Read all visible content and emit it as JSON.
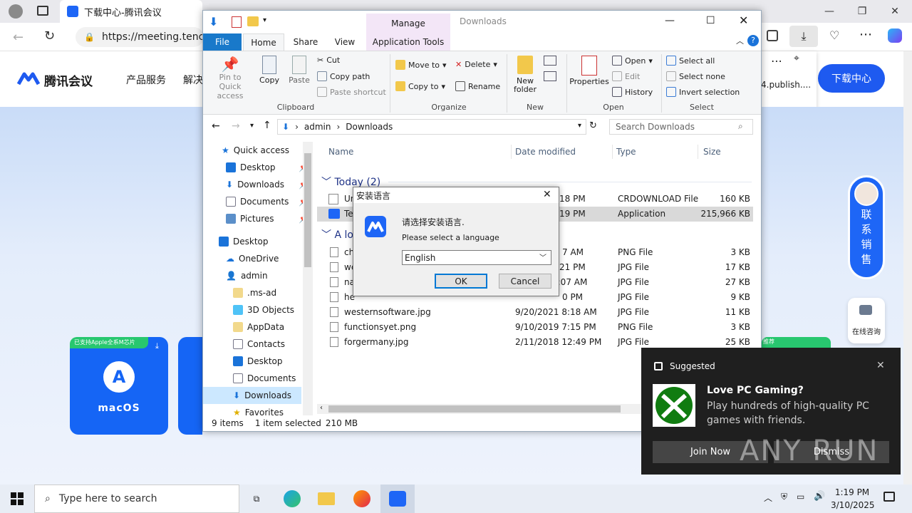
{
  "browser": {
    "tab_title": "下载中心-腾讯会议",
    "url": "https://meeting.tencen",
    "dl_panel_text": "4.publish...."
  },
  "site": {
    "logo_text": "腾讯会议",
    "nav": [
      "产品服务",
      "解决"
    ],
    "download_center": "下载中心",
    "sales_chars": [
      "联",
      "系",
      "销",
      "售"
    ],
    "consult": "在线咨询",
    "card_badge": "已支持Apple全系M芯片",
    "card_label": "macOS",
    "card_tag": "推荐"
  },
  "explorer": {
    "title": "Downloads",
    "manage_tab": "Manage",
    "tabs": [
      "File",
      "Home",
      "Share",
      "View",
      "Application Tools"
    ],
    "clipboard": {
      "pin": "Pin to Quick access",
      "copy": "Copy",
      "paste": "Paste",
      "cut": "Cut",
      "copy_path": "Copy path",
      "paste_shortcut": "Paste shortcut",
      "label": "Clipboard"
    },
    "organize": {
      "move_to": "Move to",
      "copy_to": "Copy to",
      "delete": "Delete",
      "rename": "Rename",
      "label": "Organize"
    },
    "new": {
      "new_folder": "New folder",
      "label": "New"
    },
    "open": {
      "properties": "Properties",
      "open": "Open",
      "edit": "Edit",
      "history": "History",
      "label": "Open"
    },
    "select": {
      "select_all": "Select all",
      "select_none": "Select none",
      "invert": "Invert selection",
      "label": "Select"
    },
    "path": [
      "admin",
      "Downloads"
    ],
    "search_placeholder": "Search Downloads",
    "nav": [
      "Quick access",
      "Desktop",
      "Downloads",
      "Documents",
      "Pictures",
      "Desktop",
      "OneDrive",
      "admin",
      ".ms-ad",
      "3D Objects",
      "AppData",
      "Contacts",
      "Desktop",
      "Documents",
      "Downloads",
      "Favorites"
    ],
    "columns": [
      "Name",
      "Date modified",
      "Type",
      "Size"
    ],
    "group_today": "Today (2)",
    "group_long": "A lon",
    "files": [
      {
        "name": "Un",
        "date": "18 PM",
        "type": "CRDOWNLOAD File",
        "size": "160 KB"
      },
      {
        "name": "Ter",
        "date": "19 PM",
        "type": "Application",
        "size": "215,966 KB"
      },
      {
        "name": "ch",
        "date": "7 AM",
        "type": "PNG File",
        "size": "3 KB"
      },
      {
        "name": "we",
        "date": "21 PM",
        "type": "JPG File",
        "size": "17 KB"
      },
      {
        "name": "na",
        "date": "2:07 AM",
        "type": "JPG File",
        "size": "27 KB"
      },
      {
        "name": "he",
        "date": "0 PM",
        "type": "JPG File",
        "size": "9 KB"
      },
      {
        "name": "westernsoftware.jpg",
        "date": "9/20/2021 8:18 AM",
        "type": "JPG File",
        "size": "11 KB"
      },
      {
        "name": "functionsyet.png",
        "date": "9/10/2019 7:15 PM",
        "type": "PNG File",
        "size": "3 KB"
      },
      {
        "name": "forgermany.jpg",
        "date": "2/11/2018 12:49 PM",
        "type": "JPG File",
        "size": "25 KB"
      }
    ],
    "status": {
      "items": "9 items",
      "selected": "1 item selected",
      "size": "210 MB"
    }
  },
  "dialog": {
    "title": "安装语言",
    "prompt_cn": "请选择安装语言.",
    "prompt_en": "Please select a language",
    "language": "English",
    "ok": "OK",
    "cancel": "Cancel"
  },
  "toast": {
    "header": "Suggested",
    "title": "Love PC Gaming?",
    "body": "Play hundreds of high-quality PC games with friends.",
    "join": "Join Now",
    "dismiss": "Dismiss",
    "watermark": "ANY RUN"
  },
  "taskbar": {
    "search_placeholder": "Type here to search",
    "time": "1:19 PM",
    "date": "3/10/2025"
  },
  "colors": {
    "accent": "#0078d4",
    "brand": "#1e5af0",
    "xbox": "#107c10"
  }
}
